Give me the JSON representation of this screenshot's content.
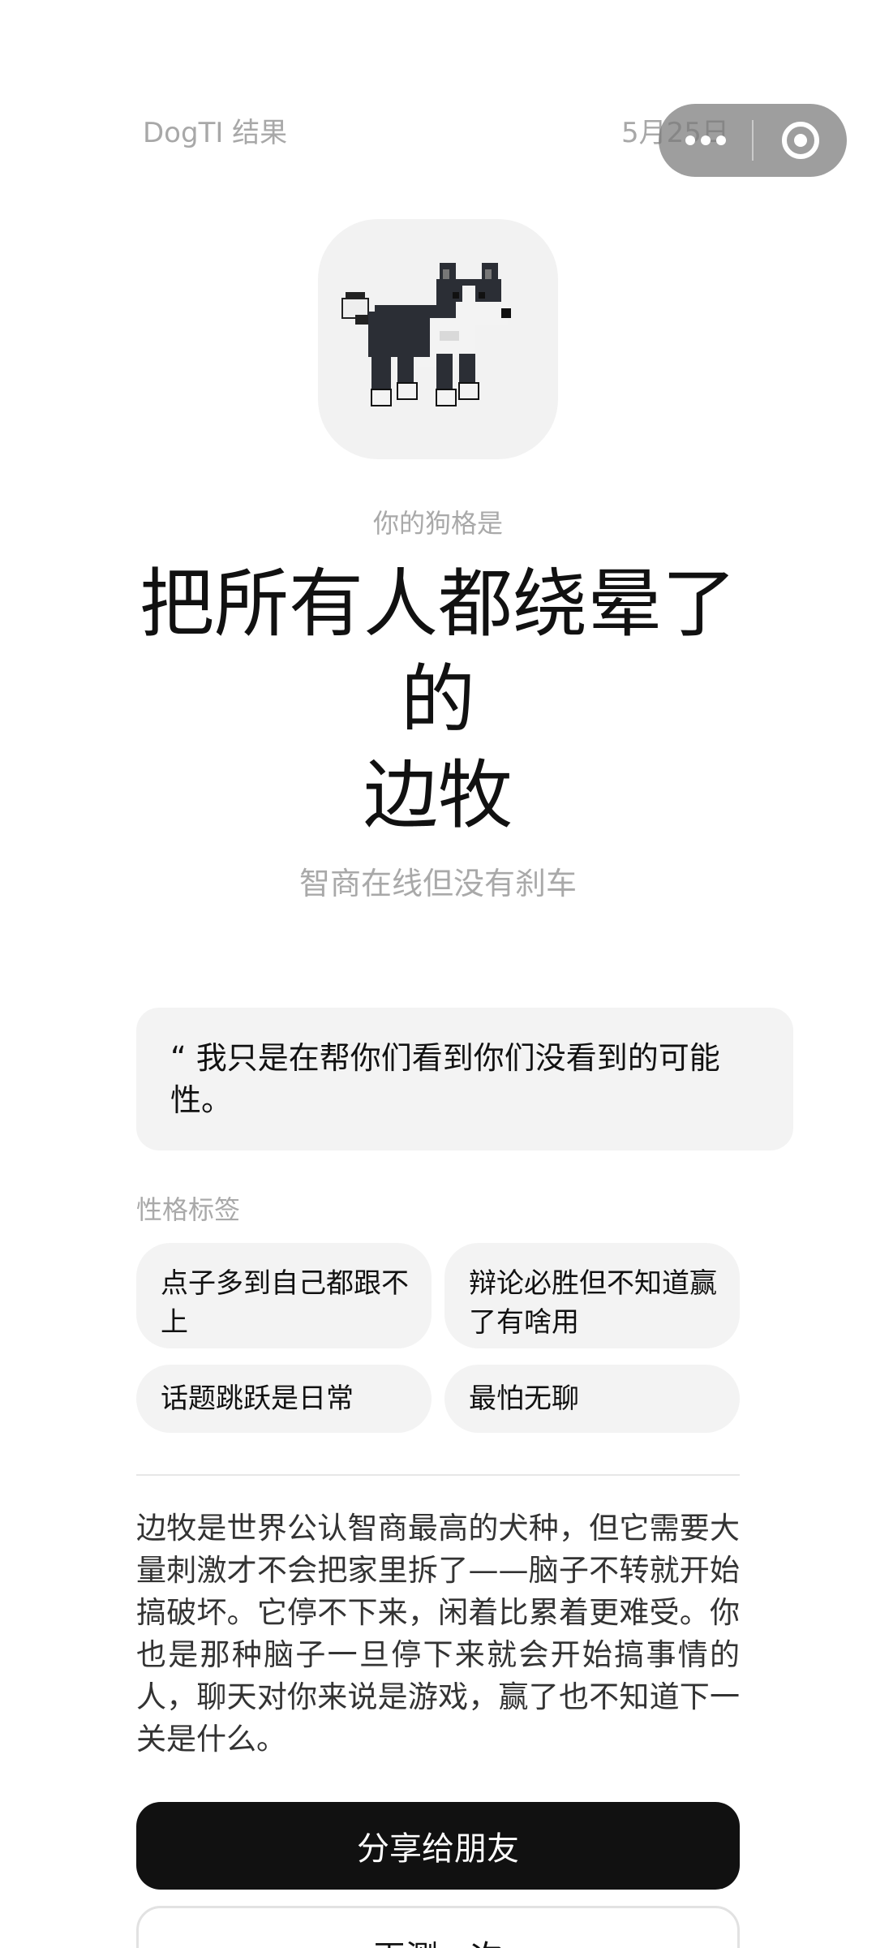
{
  "header": {
    "app_title": "DogTI 结果",
    "date": "5月25日"
  },
  "capsule": {
    "more_icon": "more-icon",
    "close_icon": "close-target-icon"
  },
  "result": {
    "intro": "你的狗格是",
    "breed_line1": "把所有人都绕晕了",
    "breed_line2": "的",
    "breed_line3": "边牧",
    "tagline": "智商在线但没有刹车",
    "avatar_icon": "pixel-border-collie-icon"
  },
  "quote": {
    "text": "“ 我只是在帮你们看到你们没看到的可能性。"
  },
  "tags": {
    "label": "性格标签",
    "items": [
      "点子多到自己都跟不上",
      "辩论必胜但不知道赢了有啥用",
      "话题跳跃是日常",
      "最怕无聊"
    ]
  },
  "description": "边牧是世界公认智商最高的犬种，但它需要大量刺激才不会把家里拆了——脑子不转就开始搞破坏。它停不下来，闲着比累着更难受。你也是那种脑子一旦停下来就会开始搞事情的人，聊天对你来说是游戏，赢了也不知道下一关是什么。",
  "actions": {
    "share_label": "分享给朋友",
    "retest_label": "再测一次"
  },
  "colors": {
    "primary_button": "#111111",
    "card_background": "#f3f3f3",
    "muted_text": "#a9a9a9"
  }
}
